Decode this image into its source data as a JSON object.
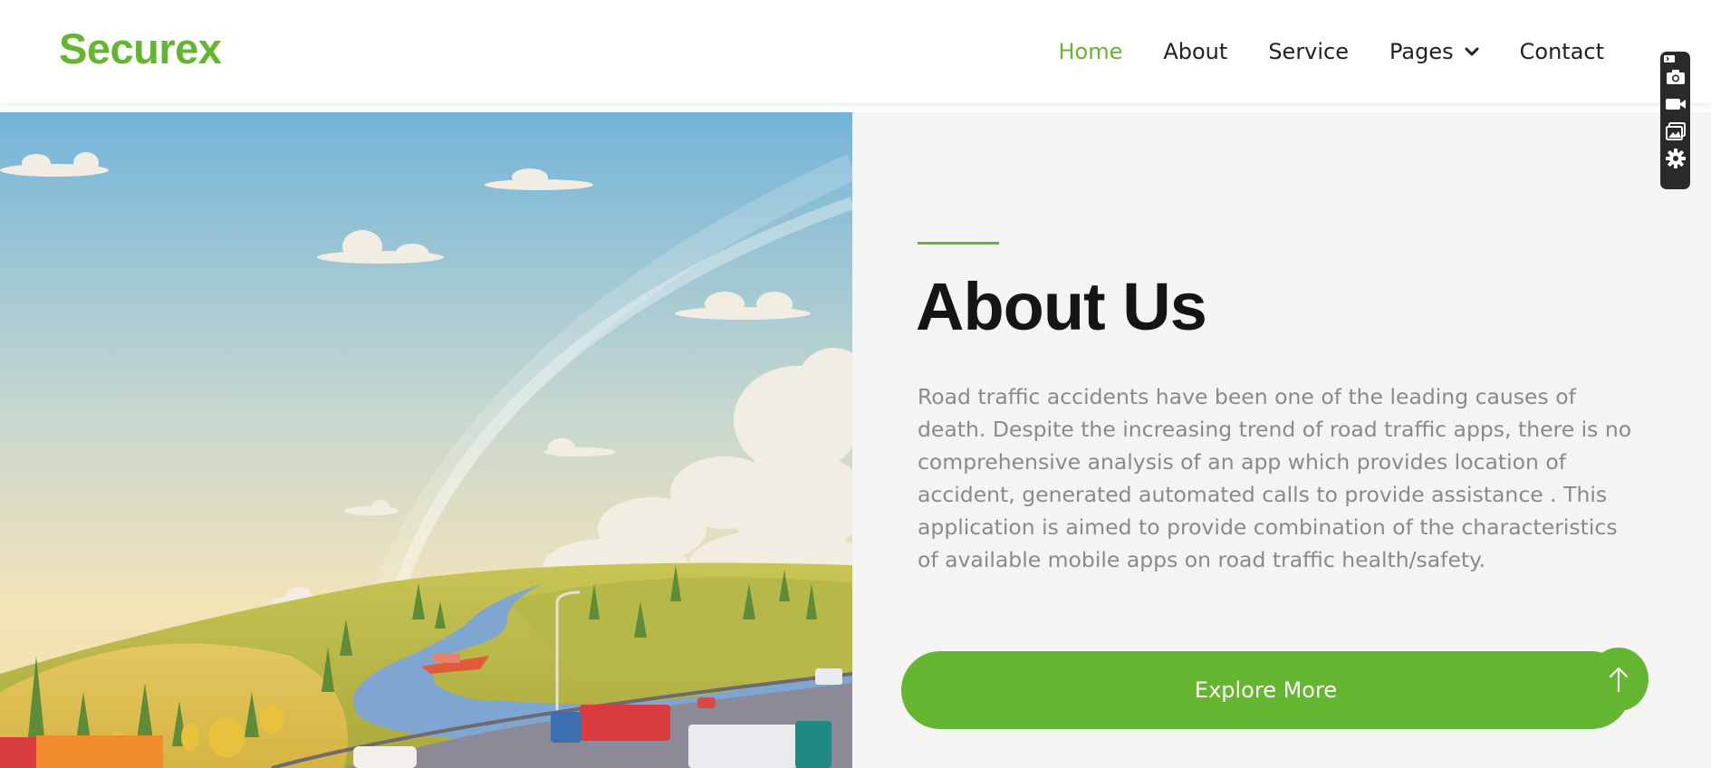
{
  "brand": {
    "name": "Securex",
    "color": "#64b52f"
  },
  "nav": {
    "items": [
      {
        "label": "Home",
        "active": true
      },
      {
        "label": "About",
        "active": false
      },
      {
        "label": "Service",
        "active": false
      },
      {
        "label": "Pages",
        "active": false,
        "icon": "chevron-down-icon"
      },
      {
        "label": "Contact",
        "active": false
      }
    ]
  },
  "about": {
    "title": "About Us",
    "paragraph": "Road traffic accidents have been one of the leading causes of death. Despite the increasing trend of road traffic apps, there is no comprehensive analysis of an app which provides location of accident, generated automated calls to provide assistance . This application is aimed to provide combination of the characteristics of available mobile apps on road traffic health/safety.",
    "button_label": "Explore More"
  },
  "hero_image": {
    "description": "highway-landscape-illustration"
  },
  "side_toolbar": {
    "icons": [
      "camera-icon",
      "video-icon",
      "gallery-icon",
      "gear-icon"
    ]
  },
  "colors": {
    "accent": "#64b52f",
    "text_dark": "#151515",
    "text_muted": "#8a8a8a",
    "panel_bg": "#f4f4f4"
  },
  "scroll_top_icon": "arrow-up-icon"
}
